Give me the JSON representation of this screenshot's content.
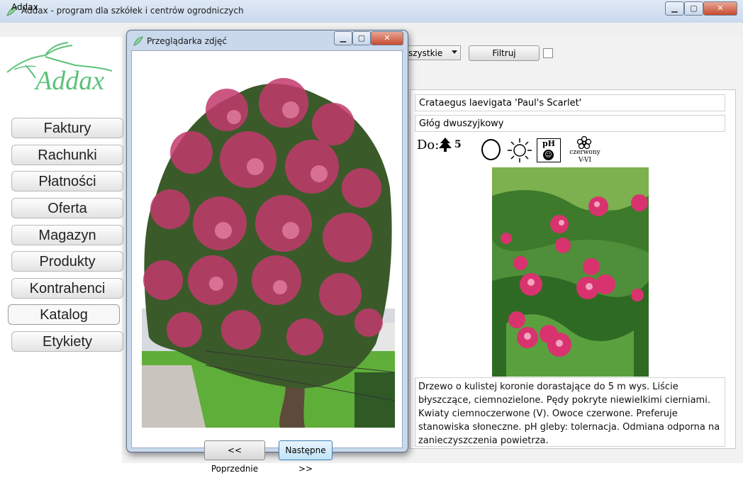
{
  "window": {
    "title": "Addax - program dla szkółek i centrów ogrodniczych",
    "minimize_glyph": "▁",
    "maximize_glyph": "▢",
    "close_glyph": "✕"
  },
  "menu": {
    "items": [
      "Addax"
    ]
  },
  "logo_text": "Addax",
  "sidebar": {
    "items": [
      {
        "label": "Faktury"
      },
      {
        "label": "Rachunki"
      },
      {
        "label": "Płatności"
      },
      {
        "label": "Oferta"
      },
      {
        "label": "Magazyn"
      },
      {
        "label": "Produkty"
      },
      {
        "label": "Kontrahenci"
      },
      {
        "label": "Katalog",
        "active": true
      },
      {
        "label": "Etykiety"
      }
    ]
  },
  "toolbar": {
    "combo_value": "szystkie",
    "filter_label": "Filtruj",
    "checkbox_checked": false
  },
  "plant": {
    "latin_name": "Crataegus laevigata 'Paul's Scarlet'",
    "polish_name": "Głóg dwuszyjkowy",
    "height_prefix": "Do:",
    "height_value": "5",
    "ph_label": "pH",
    "flower_color": "czerwony",
    "flower_months": "V-VI",
    "description": "Drzewo o kulistej koronie dorastające do 5 m wys. Liście błyszczące, ciemnozielone. Pędy pokryte niewielkimi cierniami. Kwiaty ciemnoczerwone (V). Owoce czerwone. Preferuje stanowiska słoneczne. pH gleby: tolernacja. Odmiana odporna na zanieczyszczenia powietrza."
  },
  "dialog": {
    "title": "Przeglądarka zdjęć",
    "prev_label": "<< Poprzednie",
    "next_label": "Następne >>"
  },
  "colors": {
    "logo_green": "#5cc27a",
    "flower_pink": "#d8336e",
    "leaf_green": "#3f8a2e"
  }
}
